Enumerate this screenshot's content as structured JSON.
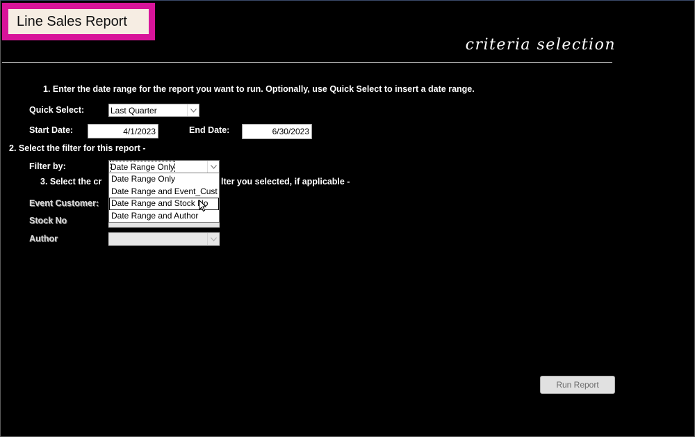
{
  "header": {
    "title": "Line Sales Report",
    "subtitle": "criteria selection"
  },
  "step1": {
    "instruction": "1. Enter the date range for the report you want to run. Optionally, use Quick Select to insert a date range.",
    "quick_select_label": "Quick Select:",
    "quick_select_value": "Last Quarter",
    "start_date_label": "Start Date:",
    "start_date_value": "4/1/2023",
    "end_date_label": "End Date:",
    "end_date_value": "6/30/2023"
  },
  "step2": {
    "instruction": "2. Select the filter for this report -",
    "filter_label": "Filter by:",
    "filter_value": "Date Range Only",
    "options": [
      "Date Range Only",
      "Date Range and Event_Cust",
      "Date Range and Stock No",
      "Date Range and Author"
    ],
    "hovered_option_index": 2
  },
  "step3": {
    "instruction_start": "3. Select the cr",
    "instruction_end": "lter you selected, if applicable -",
    "event_customer_label": "Event Customer:",
    "stock_no_label": "Stock No",
    "author_label": "Author",
    "author_value": ""
  },
  "actions": {
    "run_report_label": "Run Report"
  },
  "icons": {
    "combo_arrow": "chevron-down-icon",
    "pointer": "mouse-pointer-icon"
  },
  "colors": {
    "background": "#000000",
    "title_border": "#d8149a",
    "title_fill": "#f6ede3"
  }
}
